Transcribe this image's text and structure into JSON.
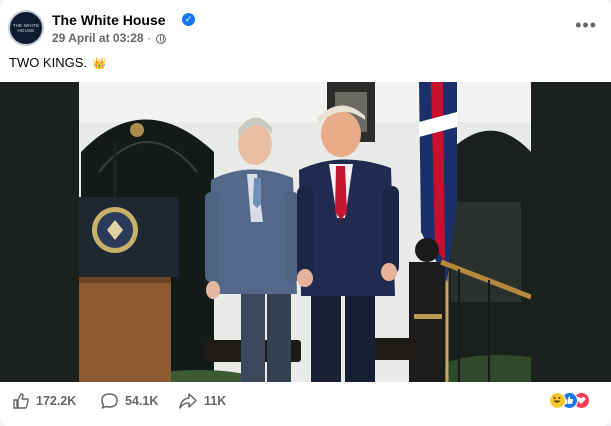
{
  "post": {
    "page_name": "The White House",
    "avatar_text": "THE WHITE HOUSE",
    "date": "29 April at 03:28",
    "separator": "·",
    "visibility_icon": "globe-icon",
    "caption": "TWO KINGS.",
    "caption_emoji": "👑",
    "more_icon": "more-options-icon",
    "verified_icon": "verified-badge-icon"
  },
  "footer": {
    "likes": "172.2K",
    "comments": "54.1K",
    "shares": "11K",
    "reactions": [
      "haha-reaction-icon",
      "like-reaction-icon",
      "love-reaction-icon"
    ]
  },
  "colors": {
    "brand_blue": "#1877f2",
    "secondary_text": "#65676b",
    "love_red": "#f33e58",
    "haha_yellow": "#f7c830"
  }
}
